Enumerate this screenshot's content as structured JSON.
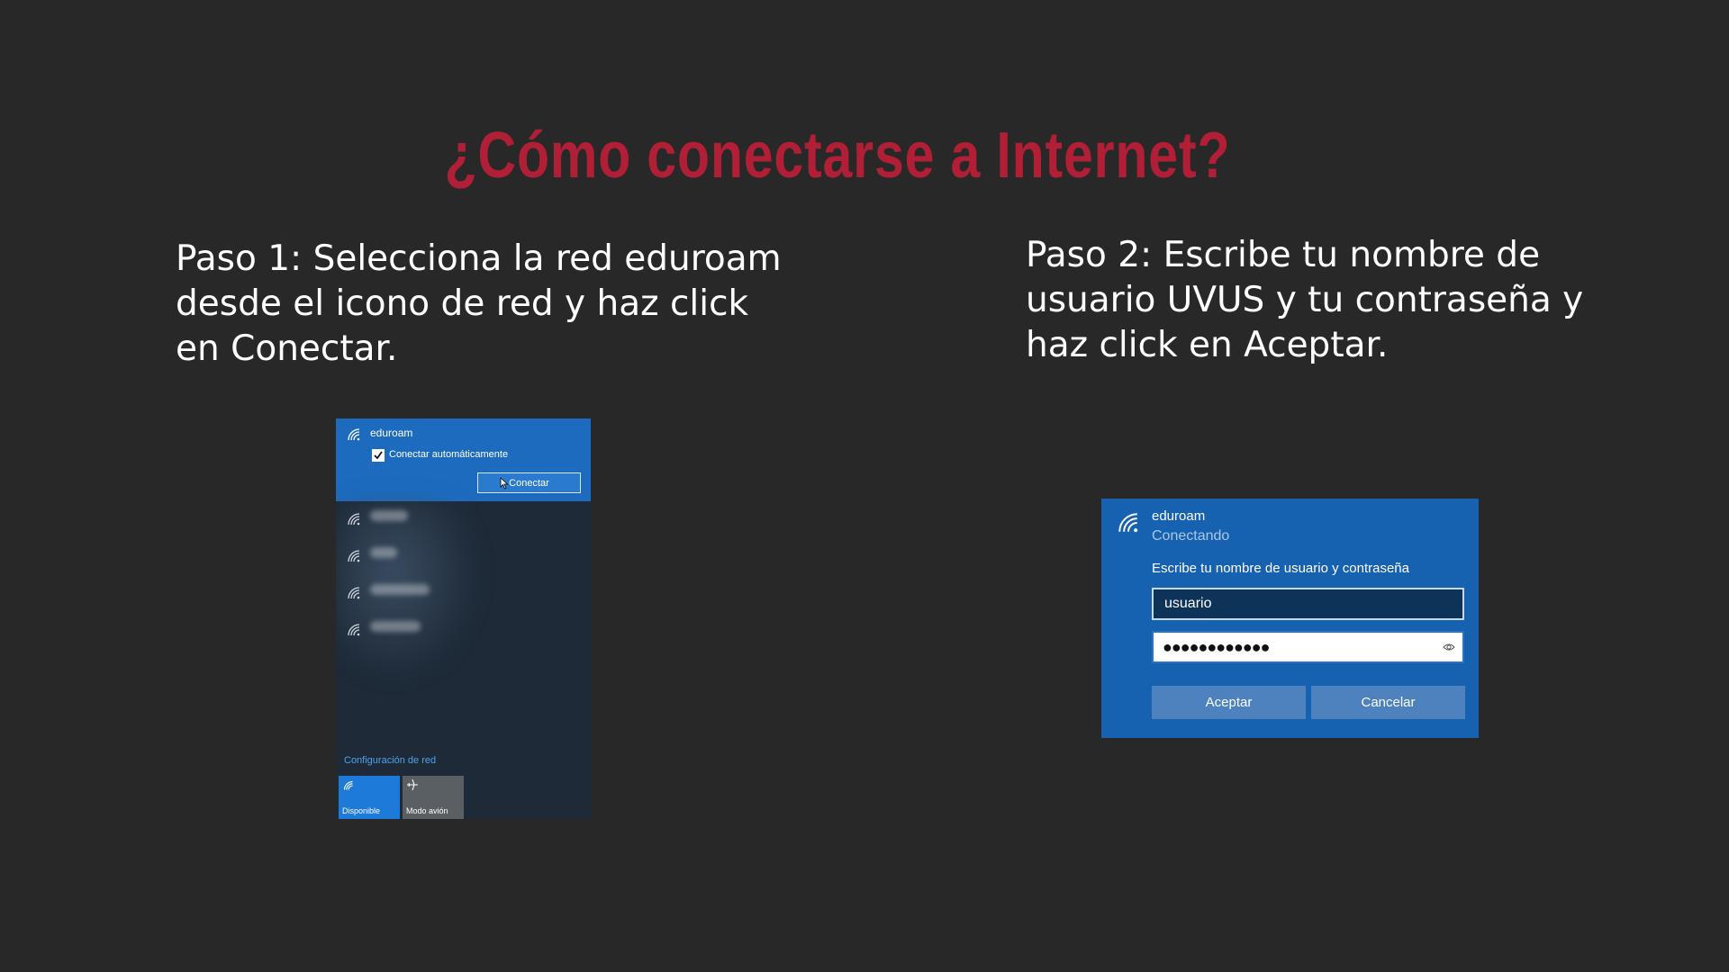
{
  "title": "¿Cómo conectarse a Internet?",
  "step1": {
    "text": "Paso 1: Selecciona la red eduroam\ndesde el icono de red y haz click\nen Conectar."
  },
  "step2": {
    "text": "Paso 2: Escribe tu nombre de\nusuario UVUS y tu contraseña y\nhaz click en Aceptar."
  },
  "flyout": {
    "network_name": "eduroam",
    "auto_connect_label": "Conectar automáticamente",
    "auto_connect_checked": true,
    "connect_button": "Conectar",
    "network_settings": "Configuración de red",
    "tiles": [
      {
        "label": "Disponible",
        "icon": "wifi-icon",
        "active": true
      },
      {
        "label": "Modo avión",
        "icon": "airplane-icon",
        "active": false
      }
    ],
    "accent": "#1c6bbf"
  },
  "dialog": {
    "network_name": "eduroam",
    "status": "Conectando",
    "prompt": "Escribe tu nombre de usuario y contraseña",
    "username_value": "usuario",
    "password_value": "●●●●●●●●●●●●",
    "ok_button": "Aceptar",
    "cancel_button": "Cancelar",
    "accent": "#1661b0"
  },
  "colors": {
    "background": "#282828",
    "title": "#b01f35",
    "text": "#ffffff"
  }
}
